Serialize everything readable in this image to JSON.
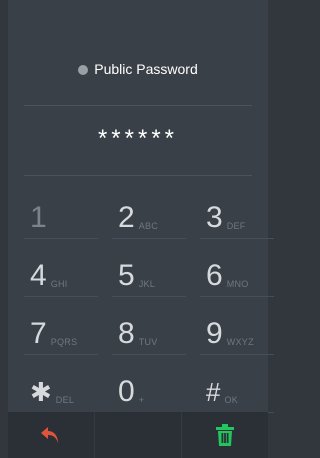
{
  "header": {
    "label": "Public Password"
  },
  "entry": {
    "masked": "******"
  },
  "keypad": {
    "rows": [
      [
        {
          "main": "1",
          "sub": ""
        },
        {
          "main": "2",
          "sub": "ABC"
        },
        {
          "main": "3",
          "sub": "DEF"
        }
      ],
      [
        {
          "main": "4",
          "sub": "GHI"
        },
        {
          "main": "5",
          "sub": "JKL"
        },
        {
          "main": "6",
          "sub": "MNO"
        }
      ],
      [
        {
          "main": "7",
          "sub": "PQRS"
        },
        {
          "main": "8",
          "sub": "TUV"
        },
        {
          "main": "9",
          "sub": "WXYZ"
        }
      ],
      [
        {
          "main": "✱",
          "sub": "DEL"
        },
        {
          "main": "0",
          "sub": "+"
        },
        {
          "main": "#",
          "sub": "OK"
        }
      ]
    ]
  },
  "icons": {
    "back": "undo-arrow-icon",
    "delete": "trash-icon",
    "back_color": "#e0533d",
    "delete_color": "#22c55e"
  }
}
